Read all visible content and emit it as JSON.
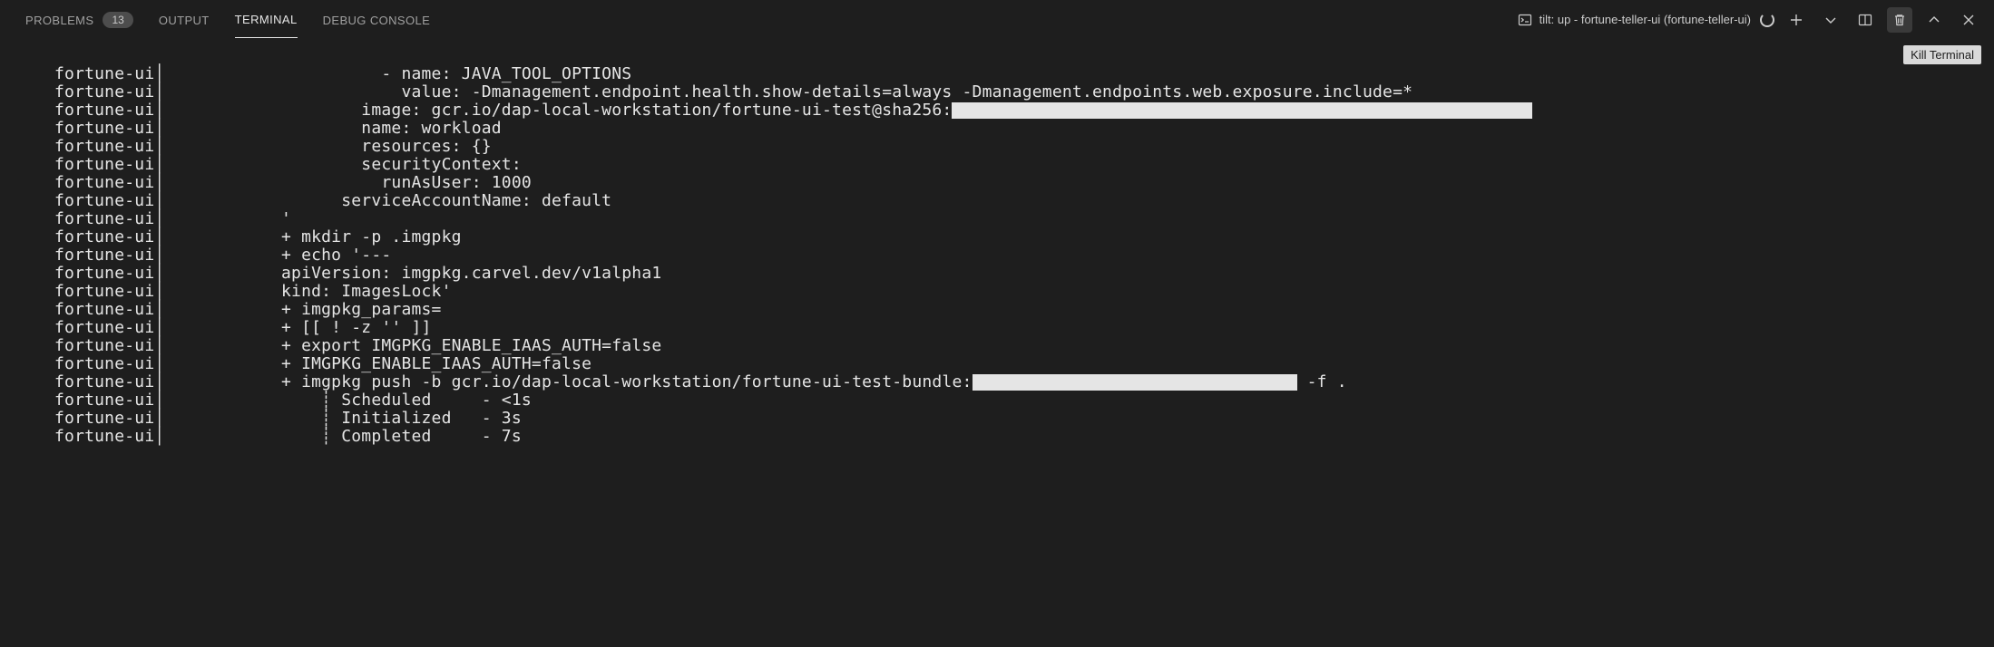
{
  "tabs": {
    "problems": {
      "label": "PROBLEMS",
      "badge": "13"
    },
    "output": {
      "label": "OUTPUT"
    },
    "terminal": {
      "label": "TERMINAL"
    },
    "debug": {
      "label": "DEBUG CONSOLE"
    }
  },
  "session": {
    "label": "tilt: up - fortune-teller-ui (fortune-teller-ui)"
  },
  "tooltip": {
    "label": "Kill Terminal"
  },
  "terminal_prefix": "fortune-ui",
  "lines": [
    {
      "text": "          - name: JAVA_TOOL_OPTIONS",
      "redacted_w": 0
    },
    {
      "text": "            value: -Dmanagement.endpoint.health.show-details=always -Dmanagement.endpoints.web.exposure.include=*",
      "redacted_w": 0
    },
    {
      "text": "        image: gcr.io/dap-local-workstation/fortune-ui-test@sha256:",
      "redacted_w": 640
    },
    {
      "text": "        name: workload",
      "redacted_w": 0
    },
    {
      "text": "        resources: {}",
      "redacted_w": 0
    },
    {
      "text": "        securityContext:",
      "redacted_w": 0
    },
    {
      "text": "          runAsUser: 1000",
      "redacted_w": 0
    },
    {
      "text": "      serviceAccountName: default",
      "redacted_w": 0
    },
    {
      "text": "'",
      "redacted_w": 0
    },
    {
      "text": "+ mkdir -p .imgpkg",
      "redacted_w": 0
    },
    {
      "text": "+ echo '---",
      "redacted_w": 0
    },
    {
      "text": "apiVersion: imgpkg.carvel.dev/v1alpha1",
      "redacted_w": 0
    },
    {
      "text": "kind: ImagesLock'",
      "redacted_w": 0
    },
    {
      "text": "+ imgpkg_params=",
      "redacted_w": 0
    },
    {
      "text": "+ [[ ! -z '' ]]",
      "redacted_w": 0
    },
    {
      "text": "+ export IMGPKG_ENABLE_IAAS_AUTH=false",
      "redacted_w": 0
    },
    {
      "text": "+ IMGPKG_ENABLE_IAAS_AUTH=false",
      "redacted_w": 0
    },
    {
      "text": "+ imgpkg push -b gcr.io/dap-local-workstation/fortune-ui-test-bundle:",
      "redacted_w": 358,
      "suffix": " -f ."
    },
    {
      "text": "    ┊ Scheduled     - <1s",
      "redacted_w": 0
    },
    {
      "text": "    ┊ Initialized   - 3s",
      "redacted_w": 0
    },
    {
      "text": "    ┊ Completed     - 7s",
      "redacted_w": 0
    }
  ]
}
